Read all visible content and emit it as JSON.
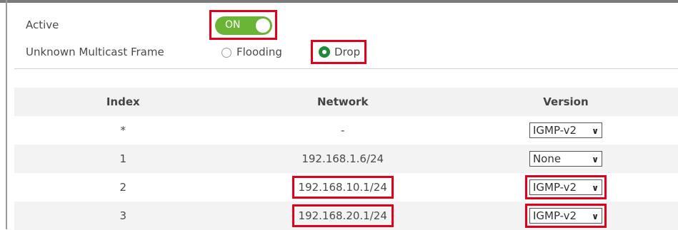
{
  "settings": {
    "active_label": "Active",
    "toggle_text": "ON",
    "toggle_state": true,
    "unknown_multicast_label": "Unknown Multicast Frame",
    "options": [
      {
        "label": "Flooding",
        "selected": false
      },
      {
        "label": "Drop",
        "selected": true
      }
    ]
  },
  "table": {
    "headers": [
      "Index",
      "Network",
      "Version"
    ],
    "rows": [
      {
        "index": "*",
        "network": "-",
        "version": "IGMP-v2"
      },
      {
        "index": "1",
        "network": "192.168.1.6/24",
        "version": "None"
      },
      {
        "index": "2",
        "network": "192.168.10.1/24",
        "version": "IGMP-v2"
      },
      {
        "index": "3",
        "network": "192.168.20.1/24",
        "version": "IGMP-v2"
      }
    ]
  },
  "colors": {
    "toggle_on": "#6ab536",
    "radio_selected": "#1f8a3a",
    "highlight": "#e0001b"
  }
}
